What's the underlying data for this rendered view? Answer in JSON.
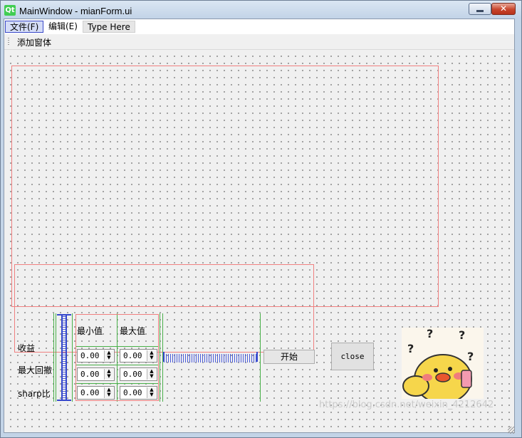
{
  "window": {
    "title": "MainWindow - mianForm.ui",
    "logo": "Qt",
    "close_glyph": "✕"
  },
  "menubar": {
    "items": [
      "文件(F)",
      "编辑(E)",
      "Type Here"
    ]
  },
  "toolbar": {
    "action": "添加窗体"
  },
  "form": {
    "row_labels": [
      "收益",
      "最大回撤",
      "sharp比"
    ],
    "col_headers": [
      "最小值",
      "最大值"
    ],
    "min_values": [
      "0.00",
      "0.00",
      "0.00"
    ],
    "max_values": [
      "0.00",
      "0.00",
      "0.00"
    ],
    "start_button": "开始",
    "close_button": "close",
    "spin_up": "▲",
    "spin_down": "▼"
  },
  "image": {
    "description_icon": "confused-chick-sticker"
  },
  "watermark": "https://blog.csdn.net/weixin_4212642"
}
